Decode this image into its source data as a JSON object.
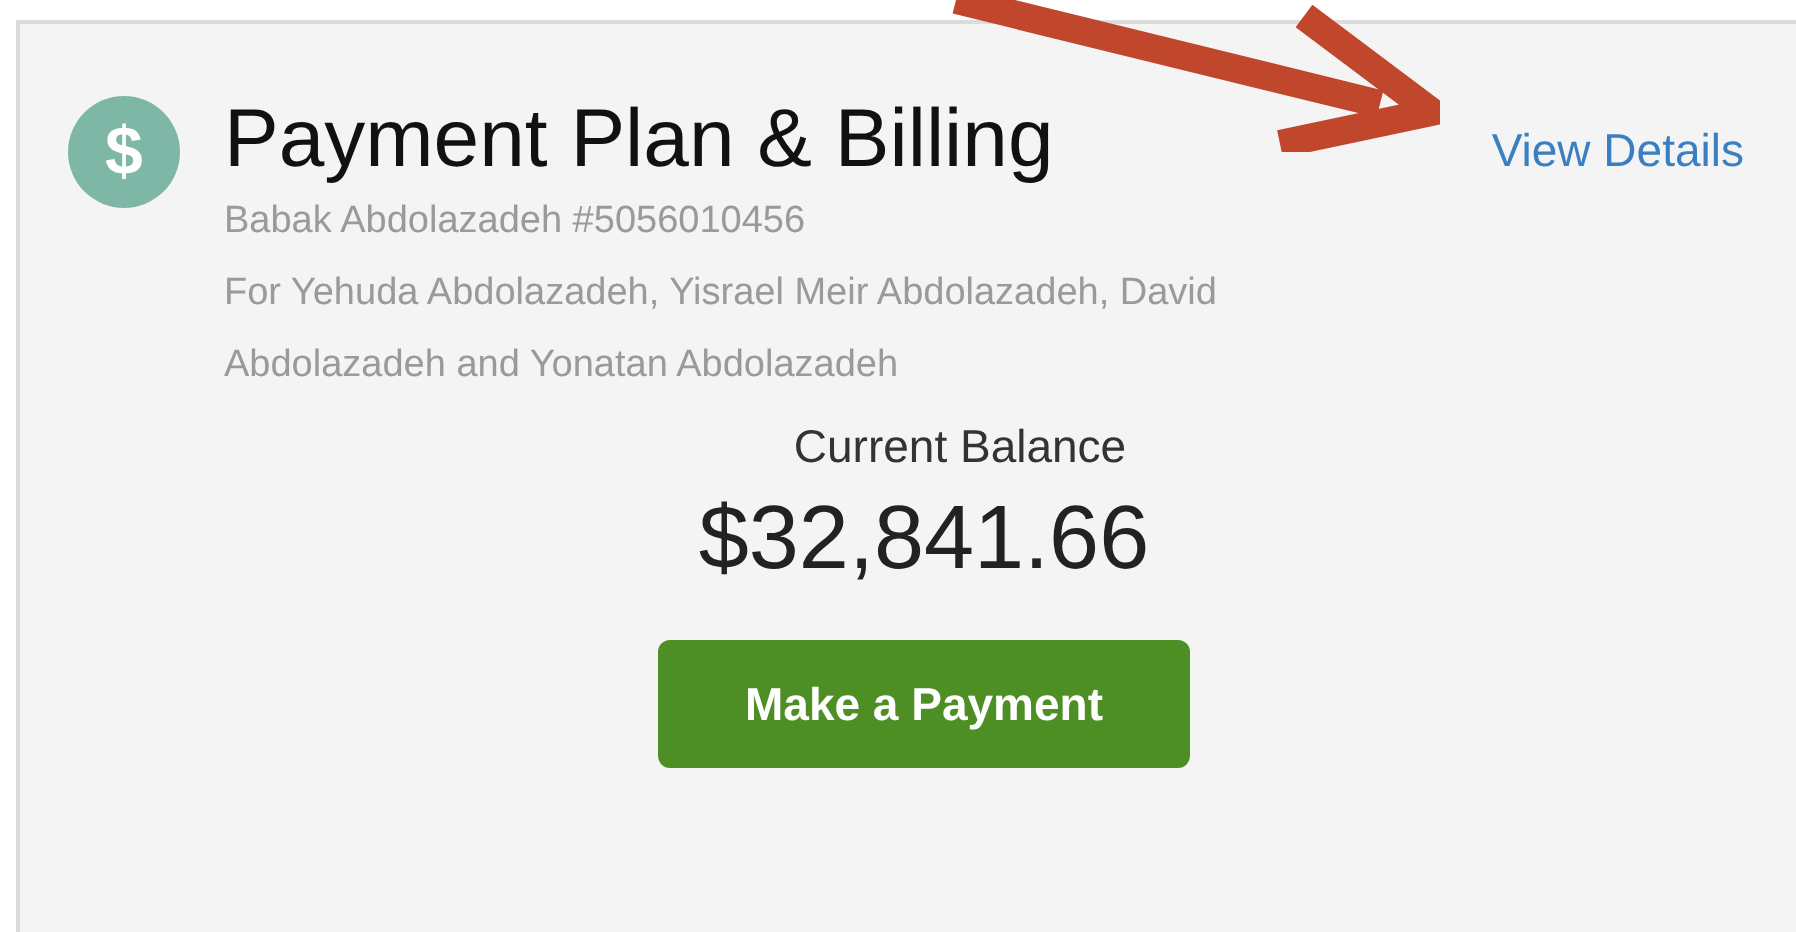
{
  "card": {
    "icon_symbol": "$",
    "title": "Payment Plan & Billing",
    "link": "View Details",
    "account": "Babak Abdolazadeh #5056010456",
    "members": "For Yehuda Abdolazadeh, Yisrael Meir Abdolazadeh, David Abdolazadeh and Yonatan Abdolazadeh",
    "balance_label": "Current Balance",
    "balance": "$32,841.66",
    "button": "Make a Payment"
  }
}
